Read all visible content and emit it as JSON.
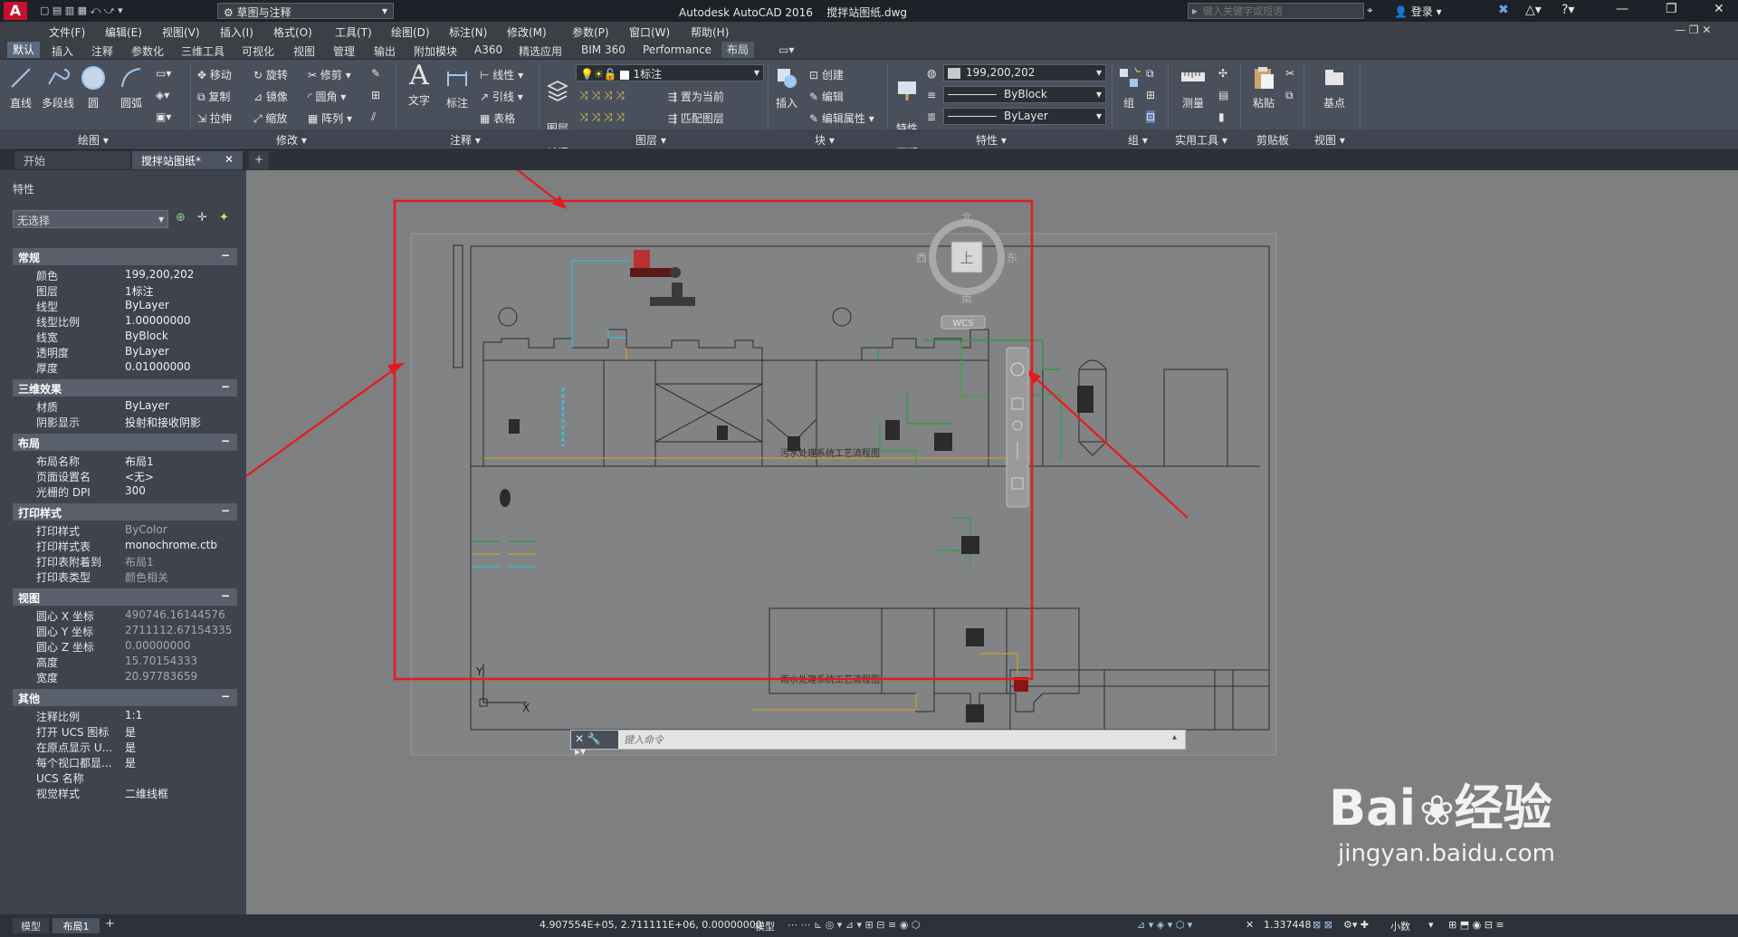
{
  "title_bar": {
    "app_title": "Autodesk AutoCAD 2016",
    "file_name": "搅拌站图纸.dwg",
    "workspace": "草图与注释",
    "search_placeholder": "键入关键字或短语",
    "login": "登录"
  },
  "menu": [
    "文件(F)",
    "编辑(E)",
    "视图(V)",
    "插入(I)",
    "格式(O)",
    "工具(T)",
    "绘图(D)",
    "标注(N)",
    "修改(M)",
    "参数(P)",
    "窗口(W)",
    "帮助(H)"
  ],
  "ribbon_tabs": [
    "默认",
    "插入",
    "注释",
    "参数化",
    "三维工具",
    "可视化",
    "视图",
    "管理",
    "输出",
    "附加模块",
    "A360",
    "精选应用",
    "BIM 360",
    "Performance",
    "布局"
  ],
  "ribbon": {
    "draw": {
      "title": "绘图",
      "line": "直线",
      "polyline": "多段线",
      "circle": "圆",
      "arc": "圆弧"
    },
    "modify": {
      "title": "修改",
      "move": "移动",
      "rotate": "旋转",
      "trim": "修剪",
      "copy": "复制",
      "mirror": "镜像",
      "fillet": "圆角",
      "stretch": "拉伸",
      "scale": "缩放",
      "array": "阵列"
    },
    "annotation": {
      "title": "注释",
      "text": "文字",
      "dimension": "标注",
      "linear": "线性",
      "leader": "引线",
      "table": "表格"
    },
    "layers": {
      "title": "图层",
      "layer_props": "图层\n特性",
      "layer_combo": "1标注",
      "make_current": "置为当前",
      "match_layer": "匹配图层"
    },
    "block": {
      "title": "块",
      "insert": "插入",
      "create": "创建",
      "edit": "编辑",
      "edit_attr": "编辑属性"
    },
    "properties": {
      "title": "特性",
      "match": "特性\n匹配",
      "color": "199,200,202",
      "linetype": "ByBlock",
      "lineweight": "ByLayer"
    },
    "groups": {
      "title": "组",
      "group": "组"
    },
    "utilities": {
      "title": "实用工具",
      "measure": "测量"
    },
    "clipboard": {
      "title": "剪贴板",
      "paste": "粘贴"
    },
    "view": {
      "title": "视图",
      "base": "基点"
    }
  },
  "doc_tabs": [
    "开始",
    "搅拌站图纸*"
  ],
  "props": {
    "title": "特性",
    "selection": "无选择",
    "sections": [
      {
        "name": "常规",
        "rows": [
          [
            "颜色",
            "199,200,202"
          ],
          [
            "图层",
            "1标注"
          ],
          [
            "线型",
            "ByLayer"
          ],
          [
            "线型比例",
            "1.00000000"
          ],
          [
            "线宽",
            "ByBlock"
          ],
          [
            "透明度",
            "ByLayer"
          ],
          [
            "厚度",
            "0.01000000"
          ]
        ]
      },
      {
        "name": "三维效果",
        "rows": [
          [
            "材质",
            "ByLayer"
          ],
          [
            "阴影显示",
            "投射和接收阴影"
          ]
        ]
      },
      {
        "name": "布局",
        "rows": [
          [
            "布局名称",
            "布局1"
          ],
          [
            "页面设置名",
            "<无>"
          ],
          [
            "光栅的 DPI",
            "300"
          ]
        ]
      },
      {
        "name": "打印样式",
        "rows": [
          [
            "打印样式",
            "ByColor"
          ],
          [
            "打印样式表",
            "monochrome.ctb"
          ],
          [
            "打印表附着到",
            "布局1"
          ],
          [
            "打印表类型",
            "颜色相关"
          ]
        ]
      },
      {
        "name": "视图",
        "rows": [
          [
            "圆心 X 坐标",
            "490746.16144576"
          ],
          [
            "圆心 Y 坐标",
            "2711112.67154335"
          ],
          [
            "圆心 Z 坐标",
            "0.00000000"
          ],
          [
            "高度",
            "15.70154333"
          ],
          [
            "宽度",
            "20.97783659"
          ]
        ]
      },
      {
        "name": "其他",
        "rows": [
          [
            "注释比例",
            "1:1"
          ],
          [
            "打开 UCS 图标",
            "是"
          ],
          [
            "在原点显示 U...",
            "是"
          ],
          [
            "每个视口都显...",
            "是"
          ],
          [
            "UCS 名称",
            ""
          ],
          [
            "视觉样式",
            "二维线框"
          ]
        ]
      }
    ]
  },
  "drawing": {
    "title1": "污水处理系统工艺流程图",
    "title2": "雨水处理系统工艺流程图",
    "viewcube": {
      "north": "北",
      "south": "南",
      "east": "东",
      "west": "西",
      "top": "上",
      "wcs": "WCS"
    },
    "ucs": {
      "x": "X",
      "y": "Y"
    }
  },
  "command": {
    "placeholder": "键入命令"
  },
  "status": {
    "layout_tabs": [
      "模型",
      "布局1"
    ],
    "coords": "4.907554E+05, 2.711111E+06, 0.00000000",
    "mode": "模型",
    "scale": "1.337448",
    "units": "小数"
  },
  "watermark": {
    "brand": "Bai",
    "brand2": "经验",
    "url": "jingyan.baidu.com"
  },
  "colors": {
    "accent": "#e12b2b",
    "highlight_box": "#e8191c",
    "titlebar": "#1e2128"
  }
}
